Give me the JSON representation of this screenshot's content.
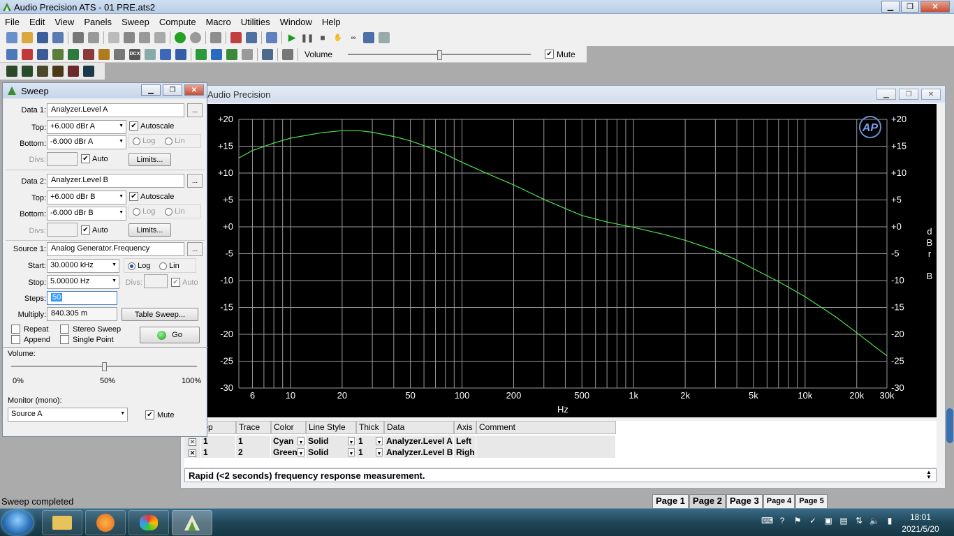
{
  "window": {
    "title": "Audio Precision ATS - 01 PRE.ats2"
  },
  "menu": [
    "File",
    "Edit",
    "View",
    "Panels",
    "Sweep",
    "Compute",
    "Macro",
    "Utilities",
    "Window",
    "Help"
  ],
  "toolbar": {
    "volume_label": "Volume",
    "volume_level": 0.5,
    "mute_label": "Mute",
    "mute_checked": true
  },
  "sweep_panel": {
    "title": "Sweep",
    "data1": {
      "label": "Data 1:",
      "value": "Analyzer.Level A",
      "top_label": "Top:",
      "top": "+6.000   dBr A",
      "bottom_label": "Bottom:",
      "bottom": "-6.000   dBr A",
      "autoscale": "Autoscale",
      "log": "Log",
      "lin": "Lin",
      "divs_label": "Divs:",
      "auto": "Auto",
      "limits": "Limits..."
    },
    "data2": {
      "label": "Data 2:",
      "value": "Analyzer.Level B",
      "top_label": "Top:",
      "top": "+6.000   dBr B",
      "bottom_label": "Bottom:",
      "bottom": "-6.000   dBr B",
      "autoscale": "Autoscale",
      "log": "Log",
      "lin": "Lin",
      "divs_label": "Divs:",
      "auto": "Auto",
      "limits": "Limits..."
    },
    "source1": {
      "label": "Source 1:",
      "value": "Analog Generator.Frequency",
      "start_label": "Start:",
      "start": "30.0000 kHz",
      "stop_label": "Stop:",
      "stop": "5.00000  Hz",
      "log": "Log",
      "lin": "Lin",
      "divs_label": "Divs:",
      "auto": "Auto",
      "steps_label": "Steps:",
      "steps": "50",
      "multiply_label": "Multiply:",
      "multiply": "840.305 m",
      "table_sweep": "Table Sweep..."
    },
    "options": {
      "repeat": "Repeat",
      "append": "Append",
      "stereo": "Stereo Sweep",
      "single": "Single Point",
      "go": "Go"
    },
    "ellipsis": "...",
    "volume": {
      "label": "Volume:",
      "min": "0%",
      "mid": "50%",
      "max": "100%",
      "level": 0.5
    },
    "monitor": {
      "label": "Monitor (mono):",
      "value": "Source A",
      "mute": "Mute"
    }
  },
  "graph": {
    "title": "Audio Precision",
    "logo": "AP",
    "unit_right": [
      "d",
      "B",
      "r",
      "B"
    ]
  },
  "chart_data": {
    "type": "line",
    "xlabel": "Hz",
    "x_scale": "log",
    "xlim": [
      5,
      30000
    ],
    "x_ticks": [
      {
        "v": 6,
        "t": "6"
      },
      {
        "v": 10,
        "t": "10"
      },
      {
        "v": 20,
        "t": "20"
      },
      {
        "v": 50,
        "t": "50"
      },
      {
        "v": 100,
        "t": "100"
      },
      {
        "v": 200,
        "t": "200"
      },
      {
        "v": 500,
        "t": "500"
      },
      {
        "v": 1000,
        "t": "1k"
      },
      {
        "v": 2000,
        "t": "2k"
      },
      {
        "v": 5000,
        "t": "5k"
      },
      {
        "v": 10000,
        "t": "10k"
      },
      {
        "v": 20000,
        "t": "20k"
      },
      {
        "v": 30000,
        "t": "30k"
      }
    ],
    "ylim": [
      -30,
      20
    ],
    "y_ticks_left": [
      "+20",
      "+15",
      "+10",
      "+5",
      "+0",
      "-5",
      "-10",
      "-15",
      "-20",
      "-25",
      "-30"
    ],
    "y_ticks_right": [
      "+20",
      "+15",
      "+10",
      "+5",
      "+0",
      "-5",
      "-10",
      "-15",
      "-20",
      "-25",
      "-30"
    ],
    "grid": true,
    "series": [
      {
        "color": "#4ee34e",
        "x": [
          5,
          6,
          8,
          10,
          15,
          20,
          25,
          30,
          40,
          50,
          60,
          70,
          80,
          100,
          150,
          200,
          300,
          400,
          500,
          700,
          1000,
          1500,
          2000,
          3000,
          4000,
          5000,
          7000,
          10000,
          15000,
          20000,
          25000,
          30000
        ],
        "y": [
          12.8,
          14.2,
          15.6,
          16.5,
          17.5,
          17.9,
          17.9,
          17.6,
          16.8,
          16.0,
          15.1,
          14.3,
          13.5,
          12.0,
          9.5,
          7.8,
          5.1,
          3.4,
          2.1,
          0.9,
          -0.1,
          -1.4,
          -2.5,
          -4.4,
          -6.2,
          -7.8,
          -10.2,
          -13.0,
          -16.7,
          -19.7,
          -22.1,
          -24.0
        ]
      }
    ]
  },
  "legend": {
    "headers": [
      "Sweep",
      "Trace",
      "Color",
      "Line Style",
      "Thick",
      "Data",
      "Axis",
      "Comment"
    ],
    "rows": [
      {
        "sweep": "1",
        "trace": "1",
        "color": "Cyan",
        "style": "Solid",
        "thick": "1",
        "data": "Analyzer.Level A",
        "axis": "Left"
      },
      {
        "sweep": "1",
        "trace": "2",
        "color": "Green",
        "style": "Solid",
        "thick": "1",
        "data": "Analyzer.Level B",
        "axis": "Righ"
      }
    ]
  },
  "comment": "Rapid (<2 seconds) frequency response measurement.",
  "status": "Sweep completed",
  "pages": [
    "Page 1",
    "Page 2",
    "Page 3",
    "Page 4",
    "Page 5"
  ],
  "clock": {
    "time": "18:01",
    "date": "2021/5/20"
  }
}
